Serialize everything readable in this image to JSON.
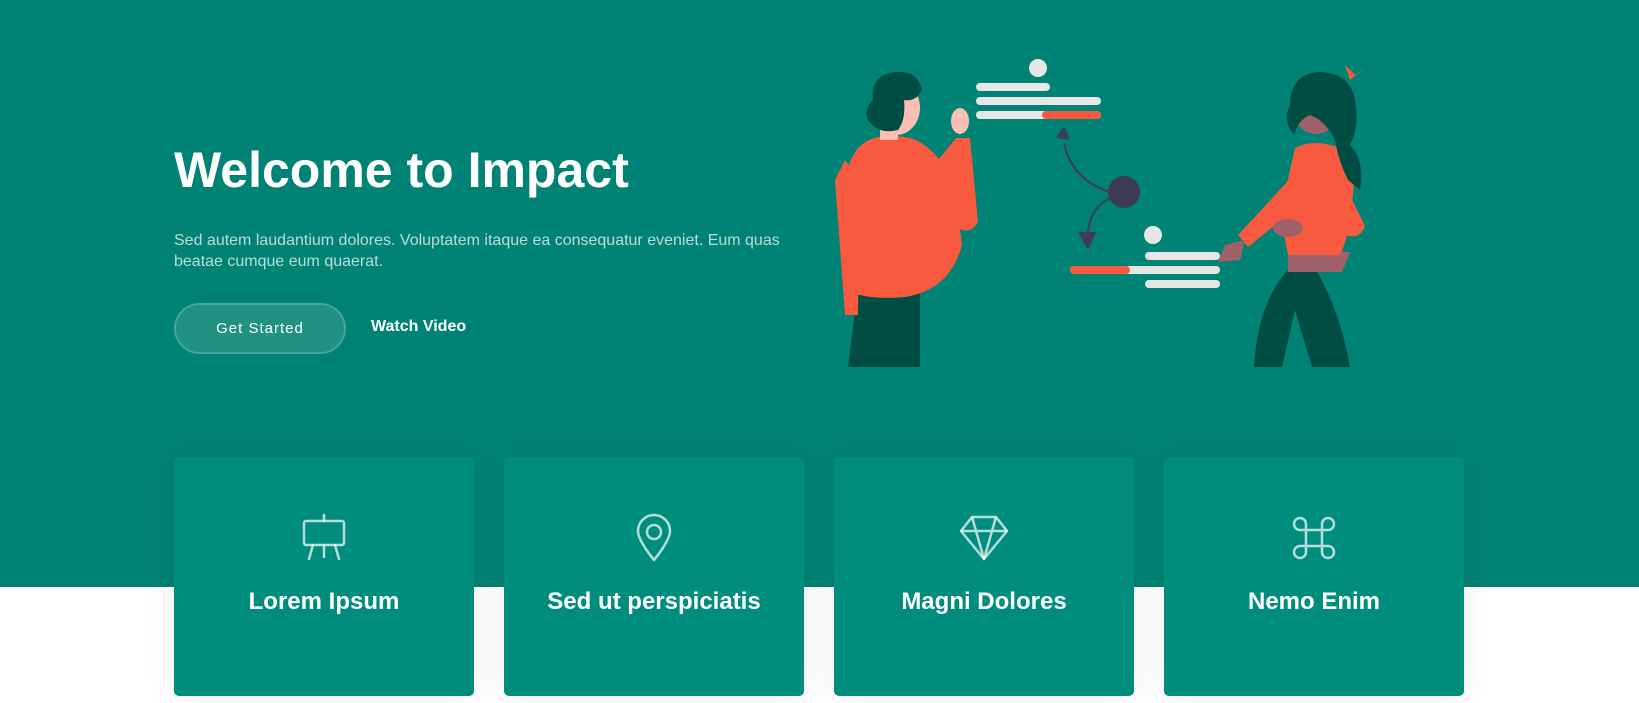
{
  "hero": {
    "title": "Welcome to Impact",
    "description": "Sed autem laudantium dolores. Voluptatem itaque ea consequatur eveniet. Eum quas beatae cumque eum quaerat.",
    "primary_button": "Get Started",
    "secondary_button": "Watch Video"
  },
  "cards": [
    {
      "title": "Lorem Ipsum",
      "icon": "easel-icon"
    },
    {
      "title": "Sed ut perspiciatis",
      "icon": "geo-alt-icon"
    },
    {
      "title": "Magni Dolores",
      "icon": "gem-icon"
    },
    {
      "title": "Nemo Enim",
      "icon": "command-icon"
    }
  ],
  "colors": {
    "hero_bg": "#008374",
    "card_bg": "#008d7d",
    "accent": "#f85a40",
    "dark_green": "#004d43",
    "white": "#ffffff"
  }
}
